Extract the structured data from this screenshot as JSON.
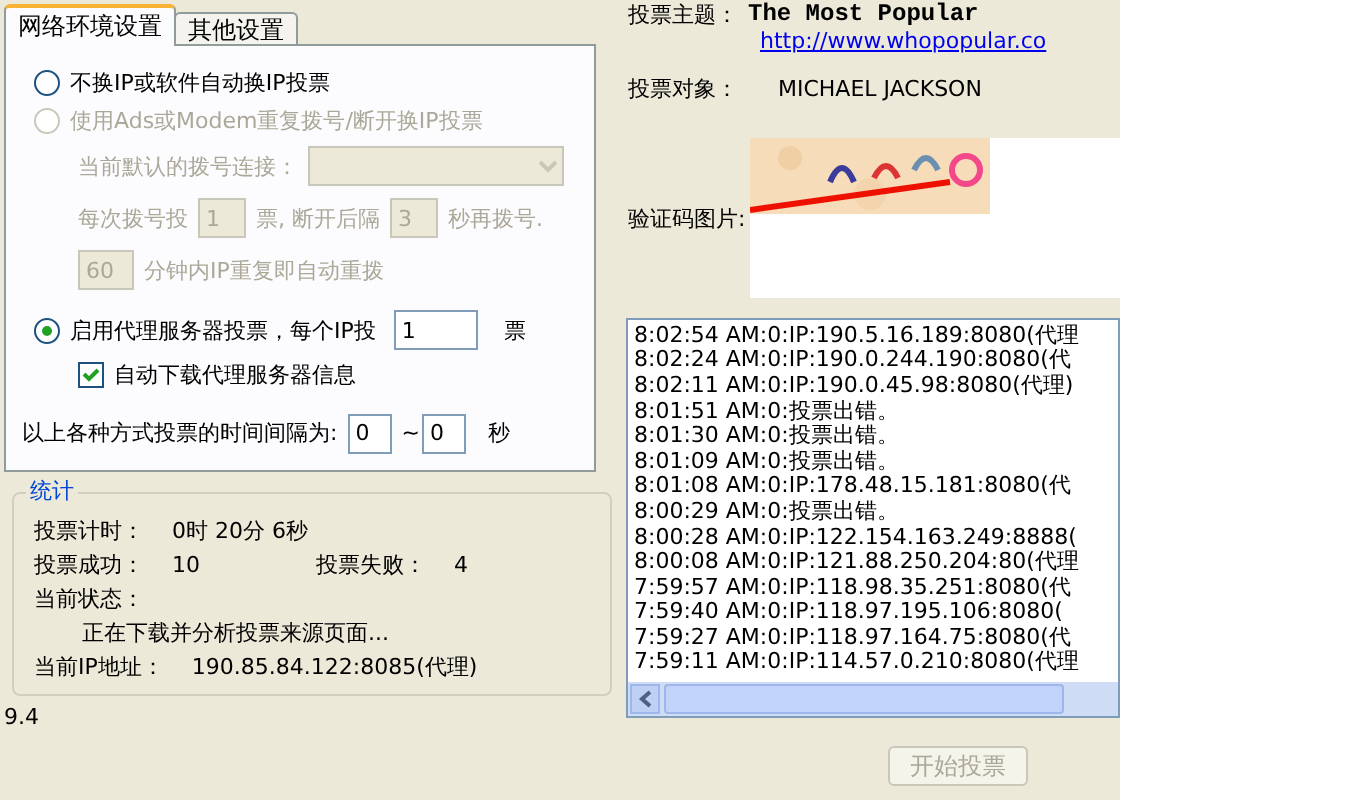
{
  "tabs": [
    {
      "label": "网络环境设置",
      "selected": true
    },
    {
      "label": "其他设置",
      "selected": false
    }
  ],
  "options": [
    {
      "kind": "plain",
      "label": "不换IP或软件自动换IP投票",
      "selected": false,
      "disabled": false
    },
    {
      "kind": "plain",
      "label": "使用Ads或Modem重复拨号/断开换IP投票",
      "selected": false,
      "disabled": true
    },
    {
      "kind": "proxy",
      "label": "启用代理服务器投票，每个IP投",
      "value": "1",
      "unit": "票",
      "selected": true,
      "disabled": false
    }
  ],
  "dial": {
    "disabled": true,
    "connection_label": "当前默认的拨号连接：",
    "votes_prefix": "每次拨号投",
    "votes_value": "1",
    "votes_suffix": "票, 断开后隔",
    "wait_value": "3",
    "wait_suffix": "秒再拨号.",
    "redial_value": "60",
    "redial_suffix": "分钟内IP重复即自动重拨"
  },
  "auto_download": {
    "label": "自动下载代理服务器信息",
    "checked": true
  },
  "interval": {
    "label": "以上各种方式投票的时间间隔为:",
    "from": "0",
    "separator": "~",
    "to": "0",
    "unit": "秒"
  },
  "stats": {
    "title": "统计",
    "timer_label": "投票计时：",
    "timer": "0时 20分 6秒",
    "success_label": "投票成功：",
    "success": "10",
    "fail_label": "投票失败：",
    "fail": "4",
    "status_label": "当前状态：",
    "status": "正在下载并分析投票来源页面...",
    "ip_label": "当前IP地址：",
    "ip": "190.85.84.122:8085(代理)"
  },
  "version": "9.4",
  "vote": {
    "topic_label": "投票主题：",
    "topic": "The Most Popular",
    "url": "http://www.whopopular.co",
    "target_label": "投票对象：",
    "target": "MICHAEL JACKSON",
    "captcha_label": "验证码图片:"
  },
  "log": [
    "8:02:54 AM:0:IP:190.5.16.189:8080(代理",
    "8:02:24 AM:0:IP:190.0.244.190:8080(代",
    "8:02:11 AM:0:IP:190.0.45.98:8080(代理)",
    "8:01:51 AM:0:投票出错。",
    "8:01:30 AM:0:投票出错。",
    "8:01:09 AM:0:投票出错。",
    "8:01:08 AM:0:IP:178.48.15.181:8080(代",
    "8:00:29 AM:0:投票出错。",
    "8:00:28 AM:0:IP:122.154.163.249:8888(",
    "8:00:08 AM:0:IP:121.88.250.204:80(代理",
    "7:59:57 AM:0:IP:118.98.35.251:8080(代",
    "7:59:40 AM:0:IP:118.97.195.106:8080(",
    "7:59:27 AM:0:IP:118.97.164.75:8080(代",
    "7:59:11 AM:0:IP:114.57.0.210:8080(代理"
  ],
  "start_button": {
    "label": "开始投票",
    "disabled": true
  }
}
